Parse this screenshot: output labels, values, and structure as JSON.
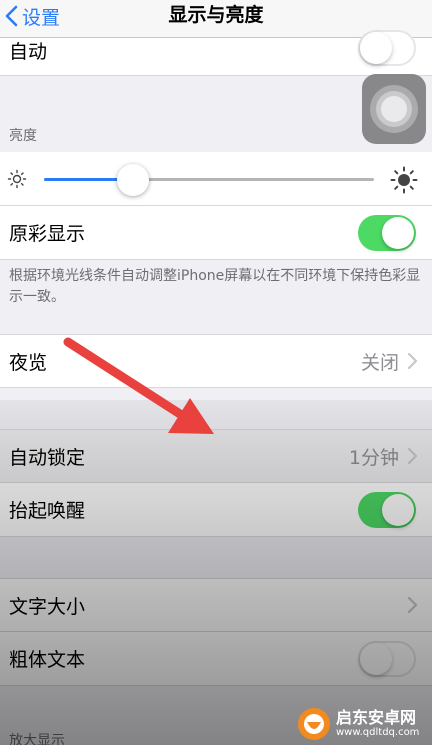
{
  "nav": {
    "back_label": "设置",
    "title": "显示与亮度"
  },
  "auto_row": {
    "label": "自动",
    "toggle": false
  },
  "brightness": {
    "section_label": "亮度",
    "level": 0.27
  },
  "true_tone": {
    "label": "原彩显示",
    "toggle": true,
    "footnote": "根据环境光线条件自动调整iPhone屏幕以在不同环境下保持色彩显示一致。"
  },
  "night_shift": {
    "label": "夜览",
    "value": "关闭"
  },
  "auto_lock": {
    "label": "自动锁定",
    "value": "1分钟"
  },
  "raise_to_wake": {
    "label": "抬起唤醒",
    "toggle": true
  },
  "text_size": {
    "label": "文字大小"
  },
  "bold_text": {
    "label": "粗体文本",
    "toggle": false
  },
  "zoom_section": {
    "label": "放大显示"
  },
  "watermark": {
    "name": "启东安卓网",
    "url": "www.qdltdq.com"
  },
  "colors": {
    "accent": "#2a7cf6",
    "switch_on": "#4cd964",
    "arrow": "#e8413e"
  }
}
